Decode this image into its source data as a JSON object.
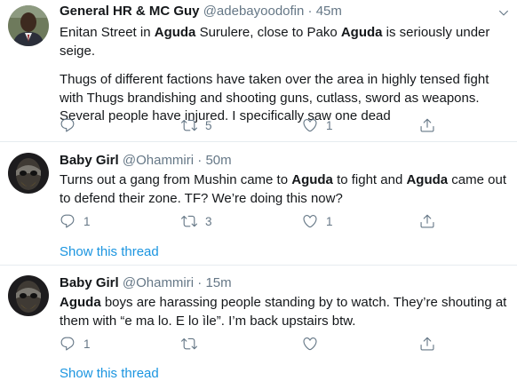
{
  "colors": {
    "accent": "#1b95e0",
    "muted": "#657786",
    "divider": "#e6ecf0"
  },
  "tweets": [
    {
      "name": "General HR & MC Guy",
      "handle": "@adebayoodofin",
      "dot": "·",
      "time": "45m",
      "paragraphs": [
        [
          {
            "t": "Enitan Street in "
          },
          {
            "t": "Aguda",
            "b": true
          },
          {
            "t": " Surulere, close to Pako "
          },
          {
            "t": "Aguda",
            "b": true
          },
          {
            "t": " is seriously under seige."
          }
        ],
        [
          {
            "t": "Thugs of different factions have taken over the area in highly tensed fight with Thugs brandishing and shooting guns, cutlass, sword as weapons. Several people have injured. I specifically saw one dead"
          }
        ]
      ],
      "reply_count": "",
      "retweet_count": "5",
      "like_count": "1"
    },
    {
      "name": "Baby Girl",
      "handle": "@Ohammiri",
      "dot": "·",
      "time": "50m",
      "paragraphs": [
        [
          {
            "t": "Turns out a gang from Mushin came to "
          },
          {
            "t": "Aguda",
            "b": true
          },
          {
            "t": " to fight and "
          },
          {
            "t": "Aguda",
            "b": true
          },
          {
            "t": " came out to defend their zone. TF? We’re doing this now?"
          }
        ]
      ],
      "reply_count": "1",
      "retweet_count": "3",
      "like_count": "1",
      "show_thread": "Show this thread"
    },
    {
      "name": "Baby Girl",
      "handle": "@Ohammiri",
      "dot": "·",
      "time": "15m",
      "paragraphs": [
        [
          {
            "t": "Aguda",
            "b": true
          },
          {
            "t": " boys are harassing people standing by to watch. They’re shouting at them with “e ma lo. E lo ìle”.  I’m back upstairs btw."
          }
        ]
      ],
      "reply_count": "1",
      "retweet_count": "",
      "like_count": "",
      "show_thread": "Show this thread"
    }
  ]
}
